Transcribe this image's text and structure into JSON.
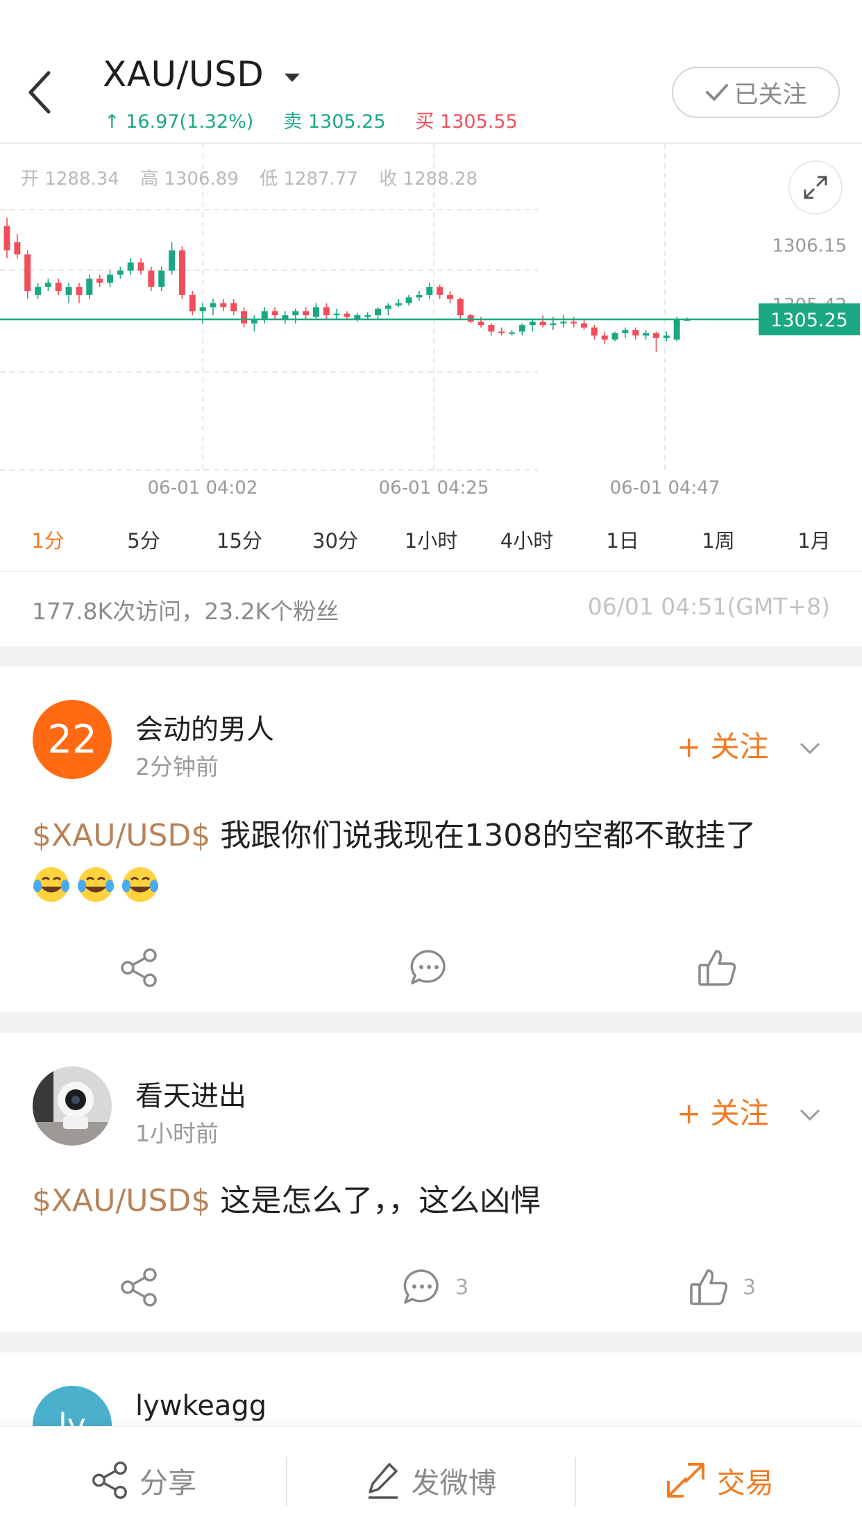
{
  "header": {
    "symbol": "XAU/USD",
    "change": "↑ 16.97(1.32%)",
    "sell_label": "卖",
    "sell_value": "1305.25",
    "buy_label": "买",
    "buy_value": "1305.55",
    "follow_label": "已关注"
  },
  "ohlc": {
    "open_label": "开",
    "open": "1288.34",
    "high_label": "高",
    "high": "1306.89",
    "low_label": "低",
    "low": "1287.77",
    "close_label": "收",
    "close": "1288.28"
  },
  "chart_data": {
    "type": "candlestick",
    "price_ticks": [
      "1306.15",
      "1305.42"
    ],
    "current_price": "1305.25",
    "time_ticks": [
      "06-01 04:02",
      "06-01 04:25",
      "06-01 04:47"
    ],
    "ylim": [
      1304.6,
      1306.6
    ],
    "colors": {
      "up": "#1aa882",
      "down": "#f04e5a"
    },
    "candles": [
      [
        1306.4,
        1306.5,
        1306.0,
        1306.1
      ],
      [
        1306.2,
        1306.3,
        1306.0,
        1306.05
      ],
      [
        1306.05,
        1306.1,
        1305.5,
        1305.6
      ],
      [
        1305.55,
        1305.7,
        1305.5,
        1305.65
      ],
      [
        1305.65,
        1305.75,
        1305.6,
        1305.7
      ],
      [
        1305.7,
        1305.75,
        1305.55,
        1305.6
      ],
      [
        1305.55,
        1305.7,
        1305.45,
        1305.65
      ],
      [
        1305.65,
        1305.7,
        1305.45,
        1305.55
      ],
      [
        1305.55,
        1305.8,
        1305.5,
        1305.75
      ],
      [
        1305.75,
        1305.8,
        1305.65,
        1305.7
      ],
      [
        1305.7,
        1305.85,
        1305.65,
        1305.8
      ],
      [
        1305.8,
        1305.9,
        1305.75,
        1305.85
      ],
      [
        1305.85,
        1306.0,
        1305.8,
        1305.95
      ],
      [
        1305.95,
        1306.0,
        1305.8,
        1305.85
      ],
      [
        1305.85,
        1305.9,
        1305.6,
        1305.65
      ],
      [
        1305.65,
        1305.9,
        1305.6,
        1305.85
      ],
      [
        1305.85,
        1306.2,
        1305.8,
        1306.1
      ],
      [
        1306.1,
        1306.15,
        1305.5,
        1305.55
      ],
      [
        1305.55,
        1305.6,
        1305.3,
        1305.35
      ],
      [
        1305.35,
        1305.45,
        1305.2,
        1305.4
      ],
      [
        1305.4,
        1305.5,
        1305.3,
        1305.45
      ],
      [
        1305.45,
        1305.5,
        1305.35,
        1305.4
      ],
      [
        1305.45,
        1305.5,
        1305.3,
        1305.35
      ],
      [
        1305.35,
        1305.4,
        1305.15,
        1305.2
      ],
      [
        1305.2,
        1305.3,
        1305.1,
        1305.25
      ],
      [
        1305.25,
        1305.4,
        1305.2,
        1305.35
      ],
      [
        1305.35,
        1305.4,
        1305.25,
        1305.3
      ],
      [
        1305.25,
        1305.35,
        1305.2,
        1305.3
      ],
      [
        1305.3,
        1305.38,
        1305.2,
        1305.35
      ],
      [
        1305.35,
        1305.4,
        1305.25,
        1305.3
      ],
      [
        1305.28,
        1305.45,
        1305.25,
        1305.4
      ],
      [
        1305.4,
        1305.45,
        1305.25,
        1305.3
      ],
      [
        1305.3,
        1305.38,
        1305.25,
        1305.32
      ],
      [
        1305.32,
        1305.35,
        1305.25,
        1305.28
      ],
      [
        1305.25,
        1305.33,
        1305.22,
        1305.3
      ],
      [
        1305.28,
        1305.34,
        1305.24,
        1305.3
      ],
      [
        1305.3,
        1305.4,
        1305.25,
        1305.38
      ],
      [
        1305.38,
        1305.45,
        1305.3,
        1305.42
      ],
      [
        1305.42,
        1305.5,
        1305.4,
        1305.45
      ],
      [
        1305.45,
        1305.55,
        1305.42,
        1305.52
      ],
      [
        1305.52,
        1305.6,
        1305.48,
        1305.55
      ],
      [
        1305.55,
        1305.7,
        1305.5,
        1305.65
      ],
      [
        1305.65,
        1305.68,
        1305.5,
        1305.55
      ],
      [
        1305.55,
        1305.6,
        1305.45,
        1305.5
      ],
      [
        1305.5,
        1305.52,
        1305.25,
        1305.3
      ],
      [
        1305.3,
        1305.32,
        1305.2,
        1305.22
      ],
      [
        1305.22,
        1305.28,
        1305.15,
        1305.18
      ],
      [
        1305.18,
        1305.2,
        1305.05,
        1305.1
      ],
      [
        1305.1,
        1305.15,
        1305.05,
        1305.08
      ],
      [
        1305.08,
        1305.12,
        1305.05,
        1305.09
      ],
      [
        1305.1,
        1305.2,
        1305.05,
        1305.18
      ],
      [
        1305.18,
        1305.25,
        1305.1,
        1305.22
      ],
      [
        1305.22,
        1305.3,
        1305.15,
        1305.18
      ],
      [
        1305.18,
        1305.28,
        1305.12,
        1305.2
      ],
      [
        1305.2,
        1305.3,
        1305.15,
        1305.22
      ],
      [
        1305.22,
        1305.28,
        1305.15,
        1305.2
      ],
      [
        1305.2,
        1305.25,
        1305.12,
        1305.15
      ],
      [
        1305.15,
        1305.18,
        1305.0,
        1305.05
      ],
      [
        1305.05,
        1305.1,
        1304.95,
        1305.0
      ],
      [
        1305.0,
        1305.1,
        1304.98,
        1305.08
      ],
      [
        1305.08,
        1305.15,
        1305.02,
        1305.12
      ],
      [
        1305.12,
        1305.15,
        1305.0,
        1305.05
      ],
      [
        1305.05,
        1305.12,
        1305.0,
        1305.08
      ],
      [
        1305.08,
        1305.1,
        1304.85,
        1305.02
      ],
      [
        1305.02,
        1305.1,
        1304.98,
        1305.05
      ],
      [
        1305.0,
        1305.28,
        1304.98,
        1305.25
      ],
      [
        1305.25,
        1305.27,
        1305.23,
        1305.25
      ]
    ]
  },
  "periods": {
    "items": [
      {
        "label": "1分"
      },
      {
        "label": "5分"
      },
      {
        "label": "15分"
      },
      {
        "label": "30分"
      },
      {
        "label": "1小时"
      },
      {
        "label": "4小时"
      },
      {
        "label": "1日"
      },
      {
        "label": "1周"
      },
      {
        "label": "1月"
      }
    ],
    "active_index": 0
  },
  "stats": {
    "summary": "177.8K次访问，23.2K个粉丝",
    "timestamp": "06/01 04:51(GMT+8)"
  },
  "posts": [
    {
      "avatar_text": "22",
      "avatar_color": "#ff6a12",
      "username": "会动的男人",
      "time": "2分钟前",
      "follow_label": "+ 关注",
      "tag": "$XAU/USD$",
      "text": "我跟你们说我现在1308的空都不敢挂了",
      "emoji": "face-with-tears-of-joy",
      "comment_count": "",
      "like_count": ""
    },
    {
      "avatar_text": "",
      "username": "看天进出",
      "time": "1小时前",
      "follow_label": "+ 关注",
      "tag": "$XAU/USD$",
      "text": "这是怎么了，，这么凶悍",
      "comment_count": "3",
      "like_count": "3"
    },
    {
      "avatar_text": "ly",
      "avatar_color": "#4ab0cc",
      "username": "lywkeagg"
    }
  ],
  "bottom_bar": {
    "share_label": "分享",
    "post_label": "发微博",
    "trade_label": "交易"
  }
}
